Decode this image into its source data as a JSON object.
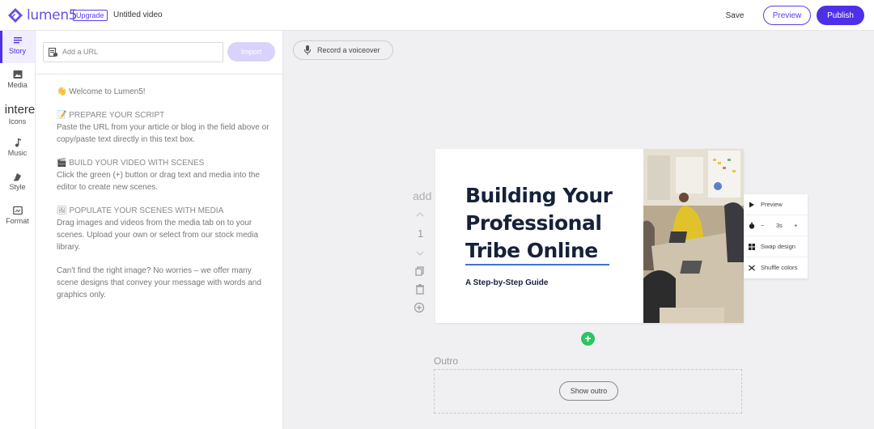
{
  "app": {
    "name": "lumen5",
    "upgrade_label": "Upgrade",
    "doc_title": "Untitled video"
  },
  "header": {
    "save_label": "Save",
    "preview_label": "Preview",
    "publish_label": "Publish"
  },
  "rail": {
    "items": [
      {
        "label": "Story",
        "icon": "story-icon",
        "active": true
      },
      {
        "label": "Media",
        "icon": "image-icon"
      },
      {
        "label": "Icons",
        "icon": "icons-icon",
        "overflow_text": "intere"
      },
      {
        "label": "Music",
        "icon": "music-note-icon"
      },
      {
        "label": "Style",
        "icon": "paint-icon"
      },
      {
        "label": "Format",
        "icon": "format-icon"
      }
    ]
  },
  "story": {
    "url_placeholder": "Add a URL",
    "import_label": "Import",
    "welcome": "👋 Welcome to Lumen5!",
    "prepare_head": "📝 PREPARE YOUR SCRIPT",
    "prepare_body": "Paste the URL from your article or blog in the field above or copy/paste text directly in this text box.",
    "build_head": "🎬 BUILD YOUR VIDEO WITH SCENES",
    "build_body": "Click the green (+) button or drag text and media into the editor to create new scenes.",
    "populate_head": "🖼 POPULATE YOUR SCENES WITH MEDIA",
    "populate_body": "Drag images and videos from the media tab on to your scenes. Upload your own or select from our stock media library.",
    "closing": "Can't find the right image? No worries – we offer many scene designs that convey your message with words and graphics only."
  },
  "canvas": {
    "voiceover_label": "Record a voiceover",
    "add_label": "add",
    "scene_number": "1",
    "slide": {
      "title_line1": "Building Your",
      "title_line2": "Professional",
      "title_line3": "Tribe Online",
      "subtitle": "A Step-by-Step Guide"
    },
    "popover": {
      "preview": "Preview",
      "duration_minus": "−",
      "duration": "3s",
      "duration_plus": "+",
      "swap_design": "Swap design",
      "shuffle_colors": "Shuffle colors"
    },
    "add_scene": "+",
    "outro_label": "Outro",
    "show_outro": "Show outro"
  },
  "colors": {
    "brand": "#4f2fe8",
    "add_green": "#2bc466",
    "rule_blue": "#3f72d6"
  }
}
